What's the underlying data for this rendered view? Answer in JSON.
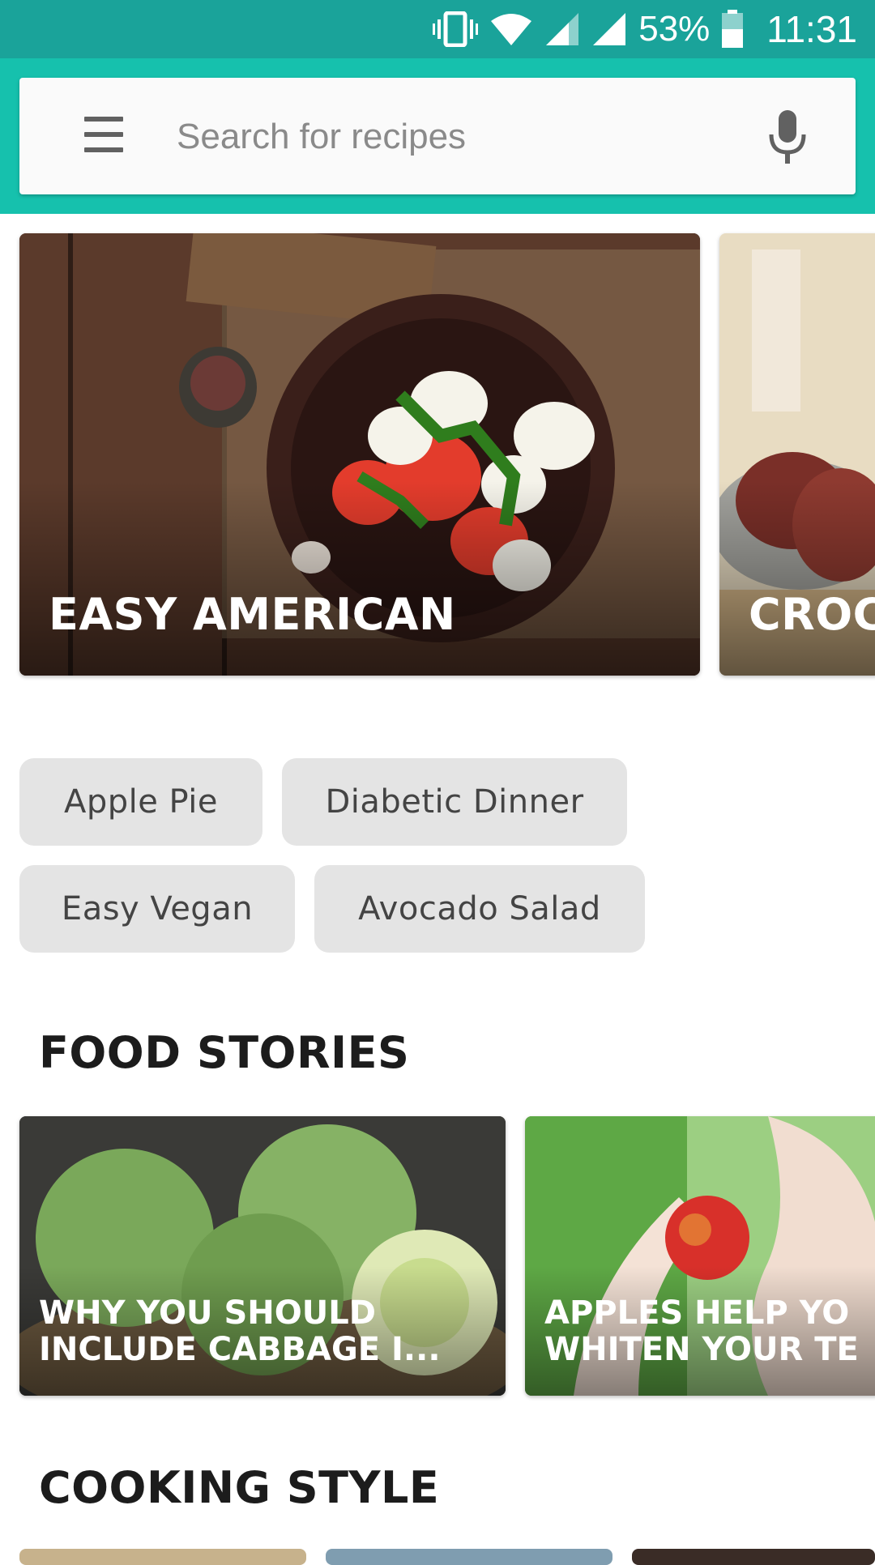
{
  "status_bar": {
    "battery": "53%",
    "time": "11:31",
    "icons": [
      "vibrate-icon",
      "wifi-icon",
      "signal-icon",
      "signal-full-icon",
      "battery-icon"
    ]
  },
  "search": {
    "placeholder": "Search for recipes",
    "value": ""
  },
  "colors": {
    "status_bar": "#1aa39a",
    "app_bar": "#16c1ad",
    "chip_bg": "#e4e4e4"
  },
  "hero_cards": [
    {
      "title": "EASY AMERICAN"
    },
    {
      "title": "CROC"
    }
  ],
  "chips": [
    "Apple Pie",
    "Diabetic Dinner",
    "Easy Vegan",
    "Avocado Salad"
  ],
  "sections": {
    "food_stories": "FOOD STORIES",
    "cooking_style": "COOKING STYLE"
  },
  "stories": [
    {
      "line1": "WHY YOU SHOULD",
      "line2": "INCLUDE CABBAGE I..."
    },
    {
      "line1": "APPLES HELP YO",
      "line2": "WHITEN YOUR TE"
    }
  ]
}
